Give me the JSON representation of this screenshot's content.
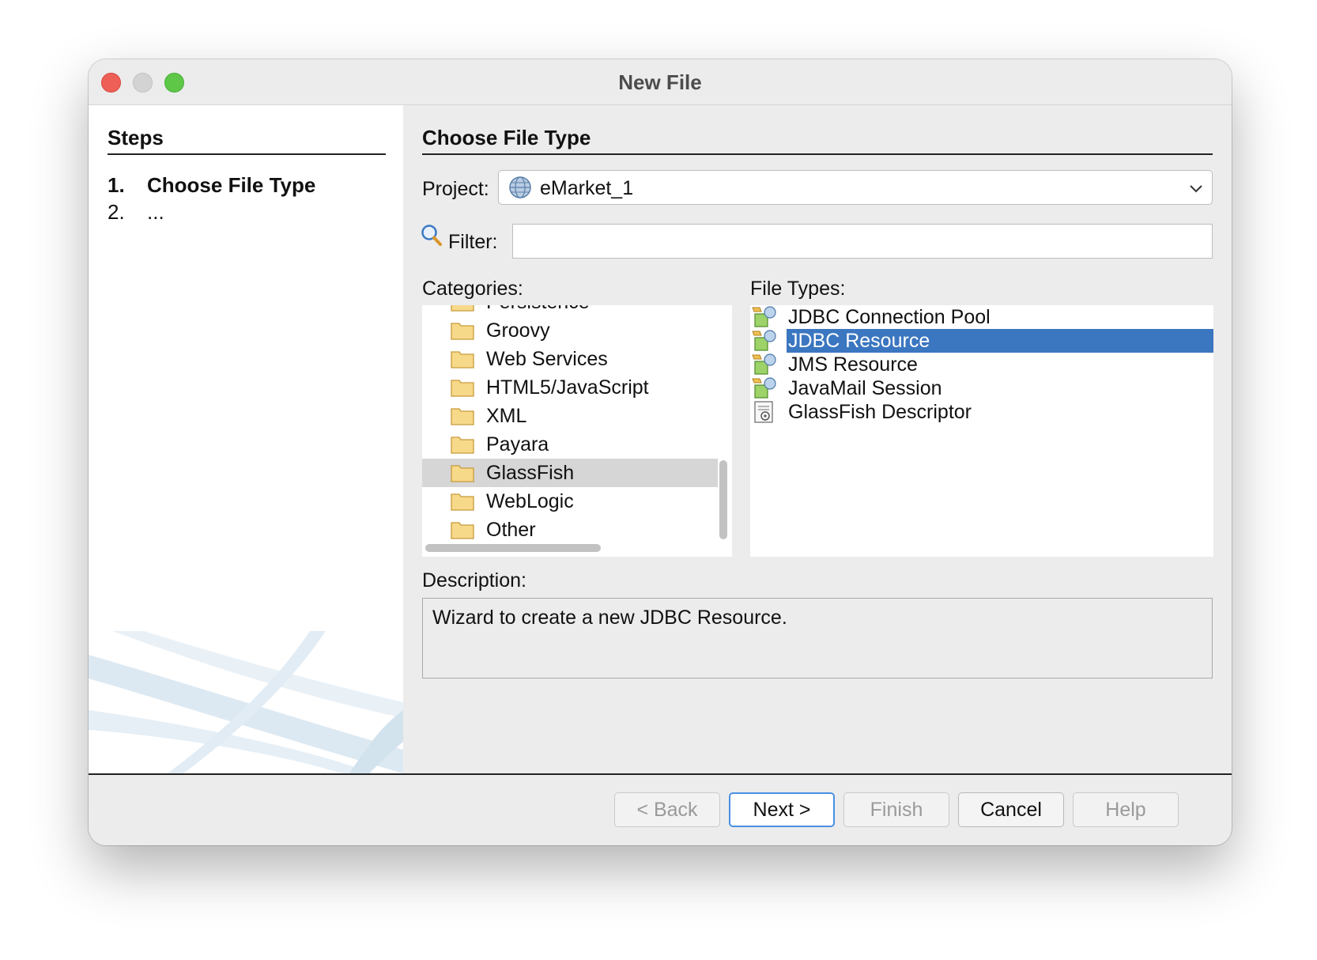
{
  "window": {
    "title": "New File"
  },
  "steps": {
    "heading": "Steps",
    "items": [
      {
        "num": "1.",
        "label": "Choose File Type"
      },
      {
        "num": "2.",
        "label": "..."
      }
    ]
  },
  "main": {
    "heading": "Choose File Type",
    "project_label": "Project:",
    "project_value": "eMarket_1",
    "filter_label": "Filter:",
    "filter_value": "",
    "categories_label": "Categories:",
    "categories": [
      "Persistence",
      "Groovy",
      "Web Services",
      "HTML5/JavaScript",
      "XML",
      "Payara",
      "GlassFish",
      "WebLogic",
      "Other"
    ],
    "selected_category": "GlassFish",
    "file_types_label": "File Types:",
    "file_types": [
      "JDBC Connection Pool",
      "JDBC Resource",
      "JMS Resource",
      "JavaMail Session",
      "GlassFish Descriptor"
    ],
    "selected_file_type": "JDBC Resource",
    "description_label": "Description:",
    "description": "Wizard to create a new JDBC Resource."
  },
  "buttons": {
    "back": "< Back",
    "next": "Next >",
    "finish": "Finish",
    "cancel": "Cancel",
    "help": "Help"
  },
  "colors": {
    "selection": "#3b76c0",
    "category_selection": "#d6d6d6",
    "default_button_border": "#4a90e2"
  }
}
